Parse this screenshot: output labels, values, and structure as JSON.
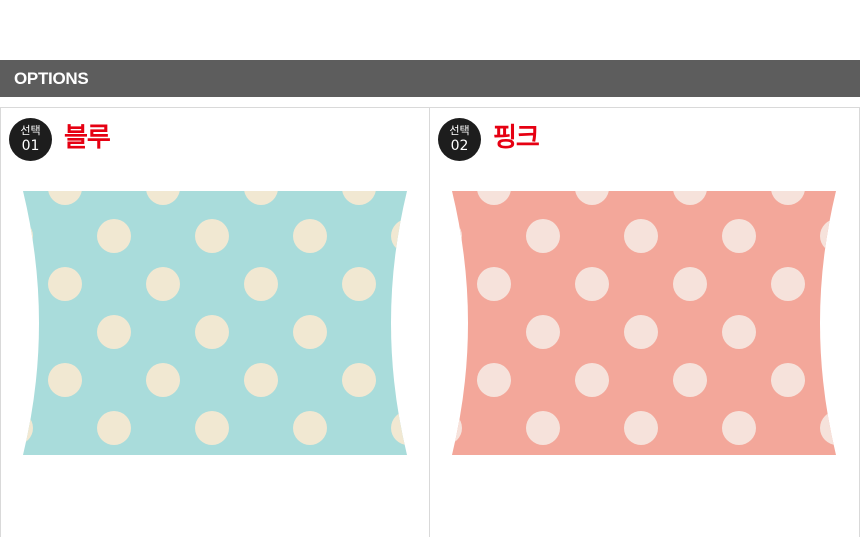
{
  "header": {
    "title": "OPTIONS"
  },
  "options": [
    {
      "badge_label": "선택",
      "badge_number": "01",
      "name": "블루",
      "box_color": "#a9dcdb",
      "dot_color": "#f1e8d2",
      "image_icon": "blue-polka-dot-pillow-box"
    },
    {
      "badge_label": "선택",
      "badge_number": "02",
      "name": "핑크",
      "box_color": "#f3a79a",
      "dot_color": "#f6e2db",
      "image_icon": "pink-polka-dot-pillow-box"
    }
  ]
}
